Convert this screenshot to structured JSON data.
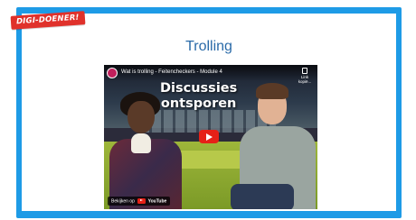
{
  "badge": {
    "label": "DIGI-DOENER!"
  },
  "page_title": "Trolling",
  "video": {
    "header_title": "Wat is trolling - Feitencheckers - Module 4",
    "copy_label": "Link kopië...",
    "overlay_line1": "Discussies",
    "overlay_line2": "ontsporen",
    "watch_on_label": "Bekijken op",
    "platform_name": "YouTube",
    "play_color": "#e62117"
  },
  "colors": {
    "frame": "#1e9be6",
    "badge": "#e0312b",
    "title": "#2a6aa8"
  }
}
